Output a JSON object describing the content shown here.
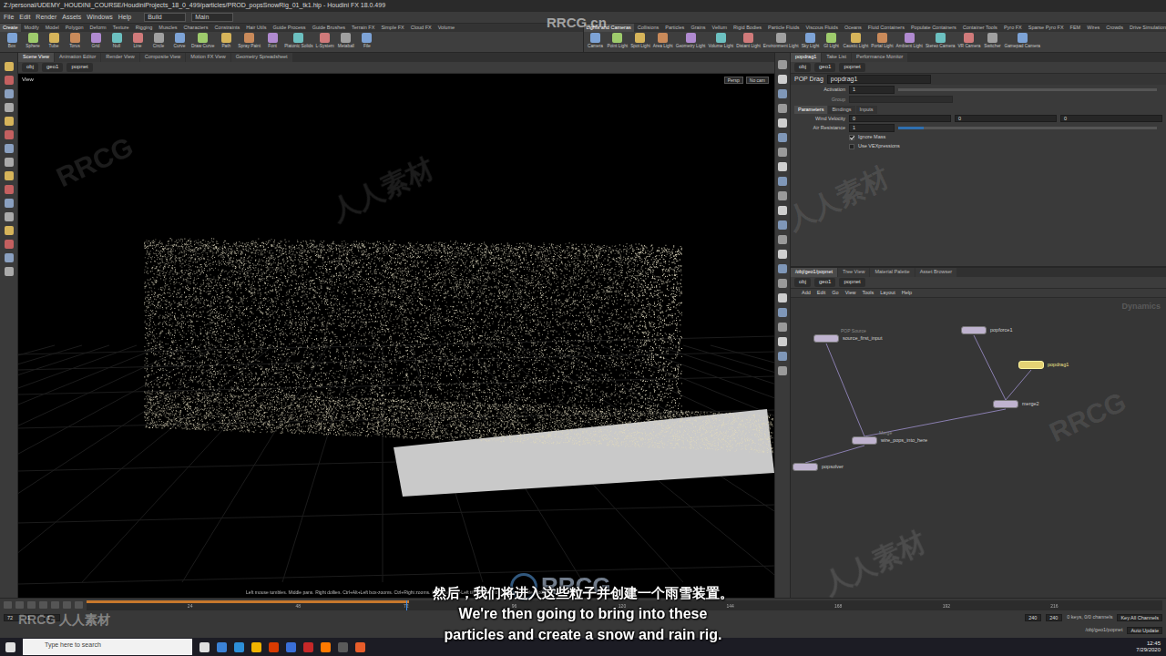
{
  "window": {
    "title": "Z:/personal/UDEMY_HOUDINI_COURSE/HoudiniProjects_18_0_499/particles/PROD_popsSnowRig_01_tk1.hip - Houdini FX 18.0.499"
  },
  "menu": [
    "File",
    "Edit",
    "Render",
    "Assets",
    "Windows",
    "Help"
  ],
  "desktop": "Build",
  "context": "Main",
  "shelf_left": {
    "tabs": [
      {
        "label": "Create",
        "selected": true
      },
      {
        "label": "Modify",
        "selected": false
      },
      {
        "label": "Model",
        "selected": false
      },
      {
        "label": "Polygon",
        "selected": false
      },
      {
        "label": "Deform",
        "selected": false
      },
      {
        "label": "Texture",
        "selected": false
      },
      {
        "label": "Rigging",
        "selected": false
      },
      {
        "label": "Muscles",
        "selected": false
      },
      {
        "label": "Characters",
        "selected": false
      },
      {
        "label": "Constraints",
        "selected": false
      },
      {
        "label": "Hair Utils",
        "selected": false
      },
      {
        "label": "Guide Process",
        "selected": false
      },
      {
        "label": "Guide Brushes",
        "selected": false
      },
      {
        "label": "Terrain FX",
        "selected": false
      },
      {
        "label": "Simple FX",
        "selected": false
      },
      {
        "label": "Cloud FX",
        "selected": false
      },
      {
        "label": "Volume",
        "selected": false
      }
    ],
    "tools": [
      "Box",
      "Sphere",
      "Tube",
      "Torus",
      "Grid",
      "Null",
      "Line",
      "Circle",
      "Curve",
      "Draw Curve",
      "Path",
      "Spray Paint",
      "Font",
      "Platonic Solids",
      "L-System",
      "Metaball",
      "File"
    ]
  },
  "shelf_right": {
    "tabs": [
      {
        "label": "Lights and Cameras",
        "selected": true
      },
      {
        "label": "Collisions",
        "selected": false
      },
      {
        "label": "Particles",
        "selected": false
      },
      {
        "label": "Grains",
        "selected": false
      },
      {
        "label": "Vellum",
        "selected": false
      },
      {
        "label": "Rigid Bodies",
        "selected": false
      },
      {
        "label": "Particle Fluids",
        "selected": false
      },
      {
        "label": "Viscous Fluids",
        "selected": false
      },
      {
        "label": "Oceans",
        "selected": false
      },
      {
        "label": "Fluid Containers",
        "selected": false
      },
      {
        "label": "Populate Containers",
        "selected": false
      },
      {
        "label": "Container Tools",
        "selected": false
      },
      {
        "label": "Pyro FX",
        "selected": false
      },
      {
        "label": "Sparse Pyro FX",
        "selected": false
      },
      {
        "label": "FEM",
        "selected": false
      },
      {
        "label": "Wires",
        "selected": false
      },
      {
        "label": "Crowds",
        "selected": false
      },
      {
        "label": "Drive Simulation",
        "selected": false
      }
    ],
    "tools": [
      "Camera",
      "Point Light",
      "Spot Light",
      "Area Light",
      "Geometry Light",
      "Volume Light",
      "Distant Light",
      "Environment Light",
      "Sky Light",
      "GI Light",
      "Caustic Light",
      "Portal Light",
      "Ambient Light",
      "Stereo Camera",
      "VR Camera",
      "Switcher",
      "Gamepad Camera"
    ]
  },
  "viewer": {
    "tabs": [
      {
        "label": "Scene View",
        "selected": true
      },
      {
        "label": "Animation Editor",
        "selected": false
      },
      {
        "label": "Render View",
        "selected": false
      },
      {
        "label": "Composite View",
        "selected": false
      },
      {
        "label": "Motion FX View",
        "selected": false
      },
      {
        "label": "Geometry Spreadsheet",
        "selected": false
      }
    ],
    "path": [
      "obj",
      "geo1",
      "popnet"
    ],
    "label": "View",
    "camera": "Persp",
    "cam_menu": "No cam",
    "hint": "Left mouse tumbles. Middle pans. Right dollies. Ctrl+Alt+Left box-zooms. Ctrl+Right zooms. Spacebar-Ctrl-Left tilts. Hold L for alternate tumble, dolly, and zoom."
  },
  "params": {
    "tabs": [
      {
        "label": "popdrag1",
        "selected": true
      },
      {
        "label": "Take List",
        "selected": false
      },
      {
        "label": "Performance Monitor",
        "selected": false
      }
    ],
    "path": [
      "obj",
      "geo1",
      "popnet"
    ],
    "node_type": "POP Drag",
    "node_name": "popdrag1",
    "activation": {
      "label": "Activation",
      "value": "1"
    },
    "group": {
      "label": "Group",
      "value": ""
    },
    "sections": [
      {
        "label": "Parameters",
        "selected": true
      },
      {
        "label": "Bindings",
        "selected": false
      },
      {
        "label": "Inputs",
        "selected": false
      }
    ],
    "wind_velocity": {
      "label": "Wind Velocity",
      "values": [
        "0",
        "0",
        "0"
      ]
    },
    "air_resistance": {
      "label": "Air Resistance",
      "value": "1",
      "level": 0.1
    },
    "toggles": [
      {
        "label": "Ignore Mass",
        "checked": true
      },
      {
        "label": "Use VEXpressions",
        "checked": false
      }
    ]
  },
  "network": {
    "tabs": [
      {
        "label": "/obj/geo1/popnet",
        "selected": true
      },
      {
        "label": "Tree View",
        "selected": false
      },
      {
        "label": "Material Palette",
        "selected": false
      },
      {
        "label": "Asset Browser",
        "selected": false
      }
    ],
    "path": [
      "obj",
      "geo1",
      "popnet"
    ],
    "menu": [
      "Add",
      "Edit",
      "Go",
      "View",
      "Tools",
      "Layout",
      "Help"
    ],
    "context_label": "Dynamics",
    "nodes": [
      {
        "label": "source_first_input",
        "type": "POP Source",
        "selected": false
      },
      {
        "label": "popforce1",
        "type": "",
        "selected": false
      },
      {
        "label": "popdrag1",
        "type": "",
        "selected": true
      },
      {
        "label": "merge2",
        "type": "",
        "selected": false
      },
      {
        "label": "wire_pops_into_here",
        "type": "Merge",
        "selected": false
      },
      {
        "label": "popsolver",
        "type": "",
        "selected": false
      }
    ]
  },
  "timeline": {
    "ticks": [
      "24",
      "48",
      "72",
      "96",
      "120",
      "144",
      "168",
      "192",
      "216"
    ],
    "frame": "72",
    "cache_level": 0.3,
    "start": "1",
    "start_range": "1",
    "end_range": "240",
    "end": "240",
    "keys": "0 keys, 0/0 channels",
    "key_all": "Key All Channels",
    "net_path": "/obj/geo1/popnet",
    "update": "Auto Update"
  },
  "subtitles": {
    "zh": "然后，我们将进入这些粒子并创建一个雨雪装置。",
    "en": [
      "We're then going to bring into these",
      "particles and create a snow and rain rig."
    ]
  },
  "watermarks": [
    "RRCG.cn",
    "人人素材",
    "RRCG",
    "人人素材",
    "RRCG",
    "人人素材",
    "RRCG 人人素材"
  ],
  "logo": "RRCG",
  "taskbar": {
    "search": "Type here to search",
    "time": "12:45",
    "date": "7/29/2020"
  }
}
